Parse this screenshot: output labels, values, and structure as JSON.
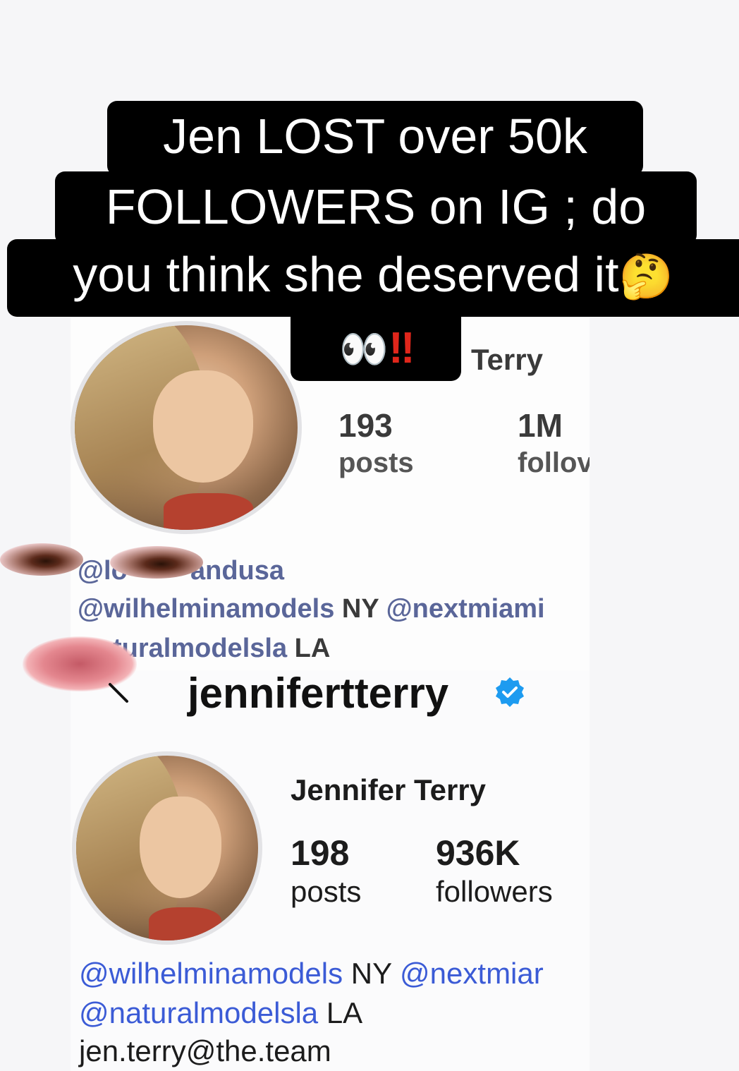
{
  "overlay": {
    "line1": "Jen LOST over 50k",
    "line2": "FOLLOWERS on IG ; do",
    "line3": "you think she deserved it",
    "line3_emoji": "🤔",
    "line4_eyes": "👀",
    "line4_bangs": "‼"
  },
  "old_profile": {
    "name_fragment": "Terry",
    "posts_count": "193",
    "posts_label": "posts",
    "followers_count": "1M",
    "followers_label": "follov",
    "bio_line1": "@lo",
    "bio_line1_end": "andusa",
    "bio_line2_link": "@wilhelminamodels",
    "bio_line2_city": "NY",
    "bio_line2_link2": "@nextmiami",
    "bio_line3_link": "turalmodelsla",
    "bio_line3_city": "LA"
  },
  "new_profile": {
    "username": "jennifertterry",
    "display_name": "Jennifer Terry",
    "posts_count": "198",
    "posts_label": "posts",
    "followers_count": "936K",
    "followers_label": "followers",
    "bio_line1_link": "@wilhelminamodels",
    "bio_line1_city": "NY",
    "bio_line1_link2": "@nextmiar",
    "bio_line2_link": "@naturalmodelsla",
    "bio_line2_city": "LA",
    "bio_line3": "jen.terry@the.team"
  },
  "icons": {
    "verified": "verified-badge-icon",
    "back": "back-chevron-icon"
  },
  "colors": {
    "link": "#3b5bd6",
    "verified": "#1d9bf0",
    "caption_bg": "#000000",
    "caption_text": "#ffffff"
  }
}
